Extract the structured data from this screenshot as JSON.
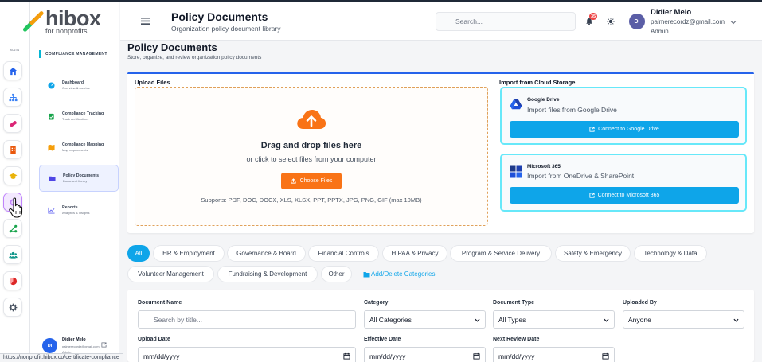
{
  "brand": {
    "name": "hibox",
    "tagline": "for nonprofits"
  },
  "rail": {
    "section_label": "MAIN",
    "items": [
      {
        "icon": "home-icon",
        "color": "#2563eb"
      },
      {
        "icon": "sitemap-icon",
        "color": "#3b82f6"
      },
      {
        "icon": "pill-icon",
        "color": "#db2777"
      },
      {
        "icon": "building-icon",
        "color": "#ea580c"
      },
      {
        "icon": "graduation-cap-icon",
        "color": "#eab308"
      },
      {
        "icon": "circle-icon",
        "color": "#9333ea"
      },
      {
        "icon": "share-nodes-icon",
        "color": "#16a34a"
      },
      {
        "icon": "users-icon",
        "color": "#0d9488"
      },
      {
        "icon": "chart-pie-icon",
        "color": "#dc2626"
      },
      {
        "icon": "gear-icon",
        "color": "#4b5563"
      }
    ]
  },
  "sidebar": {
    "section_title": "COMPLIANCE MANAGEMENT",
    "items": [
      {
        "title": "Dashboard",
        "subtitle": "Overview & metrics",
        "icon": "gauge-icon"
      },
      {
        "title": "Compliance Tracking",
        "subtitle": "Track certifications",
        "icon": "clipboard-check-icon"
      },
      {
        "title": "Compliance Mapping",
        "subtitle": "Map requirements",
        "icon": "map-icon"
      },
      {
        "title": "Policy Documents",
        "subtitle": "Document library",
        "icon": "folder-icon"
      },
      {
        "title": "Reports",
        "subtitle": "Analytics & insights",
        "icon": "chart-line-icon"
      }
    ],
    "user": {
      "initials": "DI",
      "name": "Didier Melo",
      "email": "palmerecordz@gmail.com",
      "role": "Admin"
    }
  },
  "header": {
    "title": "Policy Documents",
    "subtitle": "Organization policy document library",
    "search_placeholder": "Search...",
    "notification_count": "35",
    "user": {
      "initials": "DI",
      "name": "Didier Melo",
      "email": "palmerecordz@gmail.com",
      "role": "Admin"
    }
  },
  "page": {
    "title": "Policy Documents",
    "subtitle": "Store, organize, and review organization policy documents"
  },
  "upload": {
    "label": "Upload Files",
    "title": "Drag and drop files here",
    "subtitle": "or click to select files from your computer",
    "button": "Choose Files",
    "support": "Supports: PDF, DOC, DOCX, XLS, XLSX, PPT, PPTX, JPG, PNG, GIF (max 10MB)"
  },
  "cloud": {
    "label": "Import from Cloud Storage",
    "providers": [
      {
        "name": "Google Drive",
        "desc": "Import files from Google Drive",
        "button": "Connect to Google Drive"
      },
      {
        "name": "Microsoft 365",
        "desc": "Import from OneDrive & SharePoint",
        "button": "Connect to Microsoft 365"
      }
    ]
  },
  "tabs": [
    "All",
    "HR & Employment",
    "Governance & Board",
    "Financial Controls",
    "HIPAA & Privacy",
    "Program & Service Delivery",
    "Safety & Emergency",
    "Technology & Data",
    "Volunteer Management",
    "Fundraising & Development",
    "Other"
  ],
  "manage_categories": "Add/Delete Categories",
  "filters": {
    "doc_name_label": "Document Name",
    "doc_name_placeholder": "Search by title...",
    "category_label": "Category",
    "category_value": "All Categories",
    "type_label": "Document Type",
    "type_value": "All Types",
    "uploaded_by_label": "Uploaded By",
    "uploaded_by_value": "Anyone",
    "upload_date_label": "Upload Date",
    "upload_date_value": "mm/dd/yyyy",
    "effective_date_label": "Effective Date",
    "effective_date_value": "mm/dd/yyyy",
    "review_date_label": "Next Review Date",
    "review_date_value": "mm/dd/yyyy"
  },
  "status_url": "https://nonprofit.hibox.co/certificate-compliance"
}
